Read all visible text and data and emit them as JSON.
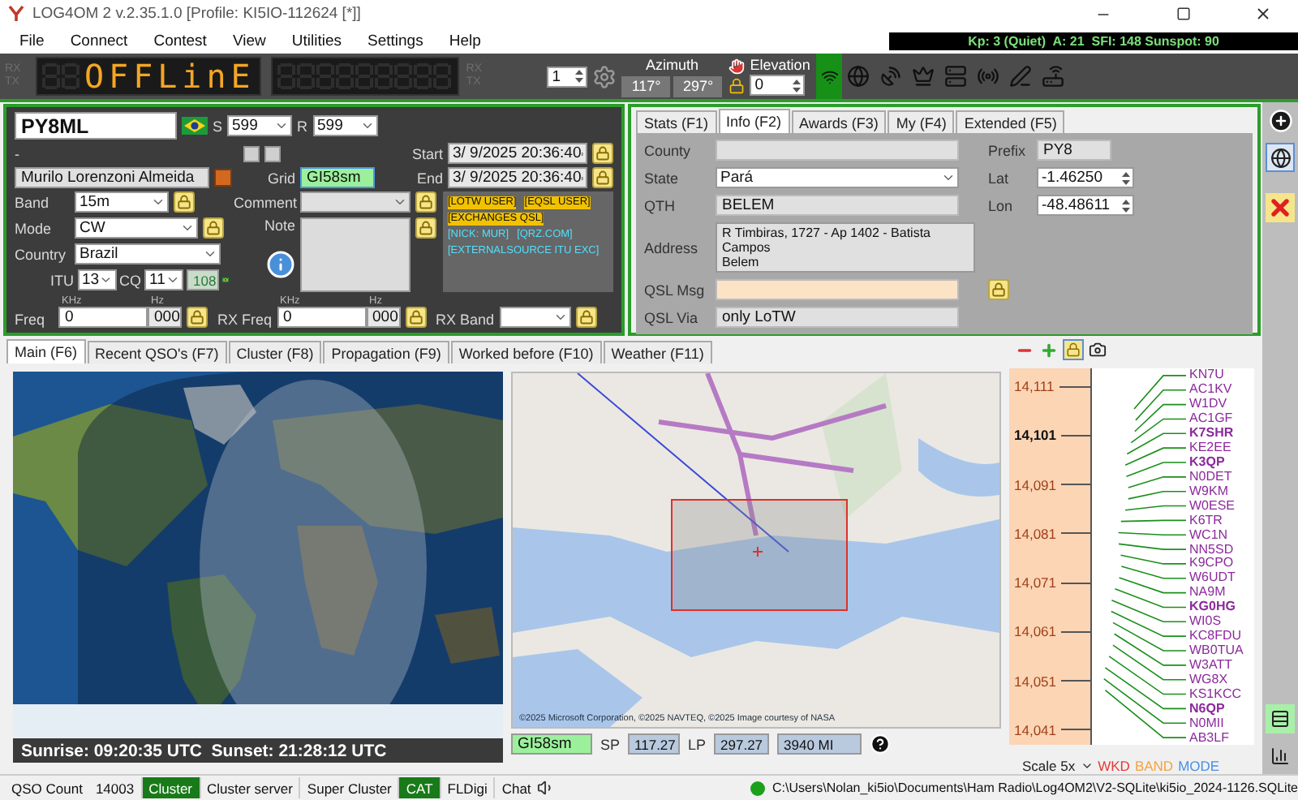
{
  "window": {
    "title": "LOG4OM 2 v.2.35.1.0 [Profile: KI5IO-112624 [*]]"
  },
  "menu": [
    "File",
    "Connect",
    "Contest",
    "View",
    "Utilities",
    "Settings",
    "Help"
  ],
  "solar": "Kp: 3 (Quiet)  A: 21  SFI: 148 Sunspot: 90",
  "toolbar": {
    "vfo_left": [
      "RX",
      "TX"
    ],
    "display": "OFFLinE",
    "vfo_right": [
      "RX",
      "TX"
    ],
    "radio": "1",
    "azimuth_label": "Azimuth",
    "azimuth": [
      "117°",
      "297°"
    ],
    "elevation_label": "Elevation",
    "elevation": "0"
  },
  "qso": {
    "callsign": "PY8ML",
    "rst_sent_label": "S",
    "rst_sent": "599",
    "rst_rcvd_label": "R",
    "rst_rcvd": "599",
    "dash": "-",
    "name": "Murilo Lorenzoni Almeida",
    "grid_label": "Grid",
    "grid": "GI58sm",
    "start_label": "Start",
    "start": "3/ 9/2025 20:36:40",
    "end_label": "End",
    "end": "3/ 9/2025 20:36:40",
    "band_label": "Band",
    "band": "15m",
    "mode_label": "Mode",
    "mode": "CW",
    "country_label": "Country",
    "country": "Brazil",
    "itu_label": "ITU",
    "itu": "13",
    "cq_label": "CQ",
    "cq": "11",
    "dxcc": "108",
    "comment_label": "Comment",
    "note_label": "Note",
    "tags": [
      {
        "text": "[LOTW USER]",
        "kind": "flag"
      },
      {
        "text": "[EQSL USER]",
        "kind": "flag"
      },
      {
        "text": "[EXCHANGES QSL]",
        "kind": "flag"
      },
      {
        "text": "[NICK: MUR]",
        "kind": "info"
      },
      {
        "text": "[QRZ.COM]",
        "kind": "info"
      },
      {
        "text": "[EXTERNALSOURCE ITU EXC]",
        "kind": "info"
      }
    ],
    "freq_khz_label": "KHz",
    "freq_hz_label": "Hz",
    "rx_khz_label": "KHz",
    "rx_hz_label": "Hz",
    "freq_label": "Freq",
    "freq_khz": "0",
    "freq_hz": "000",
    "rx_freq_label": "RX Freq",
    "rx_freq_khz": "0",
    "rx_freq_hz": "000",
    "rx_band_label": "RX Band"
  },
  "info": {
    "tabs": [
      {
        "label": "Stats (F1)",
        "selected": false
      },
      {
        "label": "Info (F2)",
        "selected": true
      },
      {
        "label": "Awards (F3)",
        "selected": false
      },
      {
        "label": "My (F4)",
        "selected": false
      },
      {
        "label": "Extended (F5)",
        "selected": false
      }
    ],
    "county_label": "County",
    "prefix_label": "Prefix",
    "prefix": "PY8",
    "state_label": "State",
    "state": "Pará",
    "lat_label": "Lat",
    "lat": "-1.46250",
    "qth_label": "QTH",
    "qth": "BELEM",
    "lon_label": "Lon",
    "lon": "-48.48611",
    "address_label": "Address",
    "address": [
      "R Timbiras, 1727 - Ap 1402 - Batista",
      "Campos",
      "Belem"
    ],
    "qsl_msg_label": "QSL Msg",
    "qsl_via_label": "QSL Via",
    "qsl_via": "only LoTW"
  },
  "main_tabs": [
    {
      "label": "Main (F6)",
      "selected": true
    },
    {
      "label": "Recent QSO's (F7)",
      "selected": false
    },
    {
      "label": "Cluster (F8)",
      "selected": false
    },
    {
      "label": "Propagation (F9)",
      "selected": false
    },
    {
      "label": "Worked before (F10)",
      "selected": false
    },
    {
      "label": "Weather (F11)",
      "selected": false
    }
  ],
  "sun_times": "Sunrise: 09:20:35 UTC  Sunset: 21:28:12 UTC",
  "map_credit": "©2025 Microsoft Corporation, ©2025 NAVTEQ, ©2025 Image courtesy of NASA",
  "path": {
    "grid": "GI58sm",
    "sp_label": "SP",
    "sp": "117.27",
    "lp_label": "LP",
    "lp": "297.27",
    "distance": "3940 MI"
  },
  "bandmap": {
    "ticks": [
      {
        "label": "14,111",
        "current": false
      },
      {
        "label": "14,101",
        "current": true
      },
      {
        "label": "14,091",
        "current": false
      },
      {
        "label": "14,081",
        "current": false
      },
      {
        "label": "14,071",
        "current": false
      },
      {
        "label": "14,061",
        "current": false
      },
      {
        "label": "14,051",
        "current": false
      },
      {
        "label": "14,041",
        "current": false
      }
    ],
    "spots": [
      {
        "call": "KN7U",
        "highlighted": false
      },
      {
        "call": "AC1KV",
        "highlighted": false
      },
      {
        "call": "W1DV",
        "highlighted": false
      },
      {
        "call": "AC1GF",
        "highlighted": false
      },
      {
        "call": "K7SHR",
        "highlighted": true
      },
      {
        "call": "KE2EE",
        "highlighted": false
      },
      {
        "call": "K3QP",
        "highlighted": true
      },
      {
        "call": "N0DET",
        "highlighted": false
      },
      {
        "call": "W9KM",
        "highlighted": false
      },
      {
        "call": "W0ESE",
        "highlighted": false
      },
      {
        "call": "K6TR",
        "highlighted": false
      },
      {
        "call": "WC1N",
        "highlighted": false
      },
      {
        "call": "NN5SD",
        "highlighted": false
      },
      {
        "call": "K9CPO",
        "highlighted": false
      },
      {
        "call": "W6UDT",
        "highlighted": false
      },
      {
        "call": "NA9M",
        "highlighted": false
      },
      {
        "call": "KG0HG",
        "highlighted": true
      },
      {
        "call": "WI0S",
        "highlighted": false
      },
      {
        "call": "KC8FDU",
        "highlighted": false
      },
      {
        "call": "WB0TUA",
        "highlighted": false
      },
      {
        "call": "W3ATT",
        "highlighted": false
      },
      {
        "call": "WG8X",
        "highlighted": false
      },
      {
        "call": "KS1KCC",
        "highlighted": false
      },
      {
        "call": "N6QP",
        "highlighted": true
      },
      {
        "call": "N0MII",
        "highlighted": false
      },
      {
        "call": "AB3LF",
        "highlighted": false
      }
    ],
    "scale": "Scale 5x",
    "legend": [
      {
        "label": "WKD",
        "color": "#e53935"
      },
      {
        "label": "BAND",
        "color": "#f4a340"
      },
      {
        "label": "MODE",
        "color": "#4a90e2"
      }
    ]
  },
  "status_bar": {
    "qso_count_label": "QSO Count",
    "qso_count": "14003",
    "items": [
      {
        "label": "Cluster",
        "on": true
      },
      {
        "label": "Cluster server",
        "on": false
      },
      {
        "label": "Super Cluster",
        "on": false
      },
      {
        "label": "CAT",
        "on": true
      },
      {
        "label": "FLDigi",
        "on": false
      },
      {
        "label": "Chat",
        "on": false
      }
    ],
    "database": "C:\\Users\\Nolan_ki5io\\Documents\\Ham Radio\\Log4OM2\\V2-SQLite\\ki5io_2024-1126.SQLite"
  }
}
